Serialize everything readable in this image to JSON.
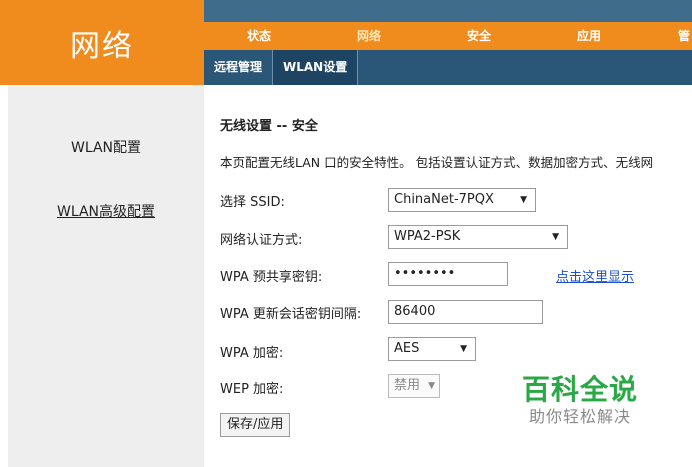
{
  "brand": {
    "title": "网络"
  },
  "main_nav": [
    {
      "label": "状态"
    },
    {
      "label": "网络"
    },
    {
      "label": "安全"
    },
    {
      "label": "应用"
    },
    {
      "label": "管"
    }
  ],
  "sub_nav": [
    {
      "label": "远程管理"
    },
    {
      "label": "WLAN设置"
    }
  ],
  "sidebar": {
    "items": [
      {
        "label": "WLAN配置"
      },
      {
        "label": "WLAN高级配置"
      }
    ]
  },
  "content": {
    "heading": "无线设置 -- 安全",
    "description": "本页配置无线LAN 口的安全特性。 包括设置认证方式、数据加密方式、无线网",
    "ssid": {
      "label": "选择 SSID:",
      "value": "ChinaNet-7PQX"
    },
    "auth": {
      "label": "网络认证方式:",
      "value": "WPA2-PSK"
    },
    "psk": {
      "label": "WPA 预共享密钥:",
      "value": "••••••••",
      "show_link": "点击这里显示"
    },
    "rekey": {
      "label": "WPA 更新会话密钥间隔:",
      "value": "86400"
    },
    "wpa_enc": {
      "label": "WPA 加密:",
      "value": "AES"
    },
    "wep_enc": {
      "label": "WEP 加密:",
      "value": "禁用"
    },
    "save_label": "保存/应用"
  },
  "watermark": {
    "title": "百科全说",
    "subtitle": "助你轻松解决"
  },
  "colors": {
    "orange": "#f08c1e",
    "nav_dark": "#2a5677",
    "link": "#1a50c8",
    "watermark_green": "#2aa845"
  }
}
